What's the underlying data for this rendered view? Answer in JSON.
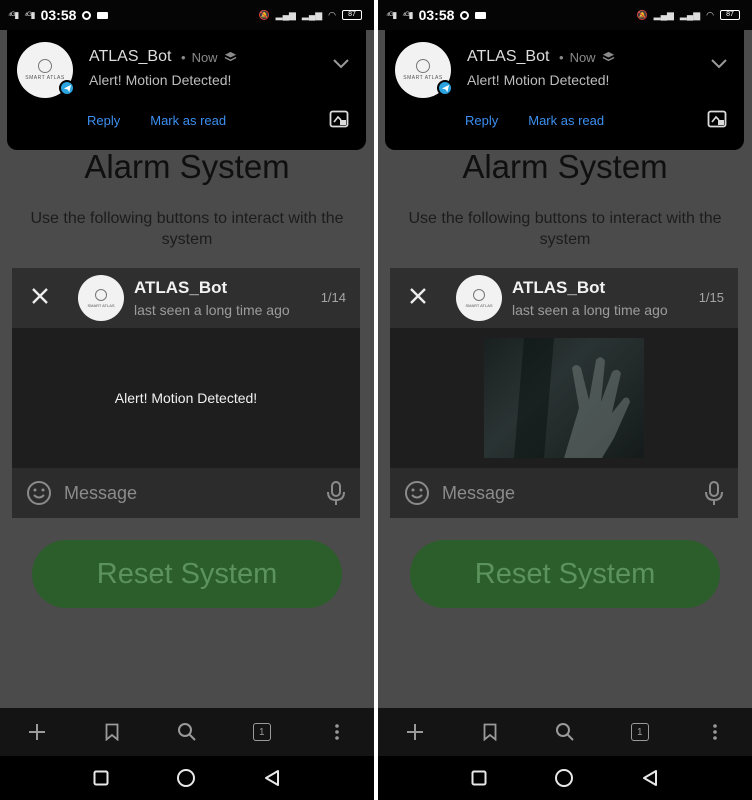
{
  "status_bar": {
    "time": "03:58",
    "battery": "87"
  },
  "page": {
    "title": "Alarm System",
    "description": "Use the following buttons to interact with the system",
    "reset_button": "Reset System"
  },
  "notification": {
    "sender": "ATLAS_Bot",
    "time": "Now",
    "message": "Alert! Motion Detected!",
    "reply_label": "Reply",
    "mark_read_label": "Mark as read"
  },
  "chat": {
    "name": "ATLAS_Bot",
    "status": "last seen a long time ago",
    "input_placeholder": "Message"
  },
  "screens": [
    {
      "counter": "1/14",
      "message_text": "Alert! Motion Detected!",
      "has_photo": false
    },
    {
      "counter": "1/15",
      "message_text": "",
      "has_photo": true
    }
  ],
  "toolbar": {
    "tab_count": "1"
  },
  "colors": {
    "link_blue": "#3c8ff0",
    "reset_green": "#2c5e2c",
    "telegram_blue": "#2aa3df"
  }
}
